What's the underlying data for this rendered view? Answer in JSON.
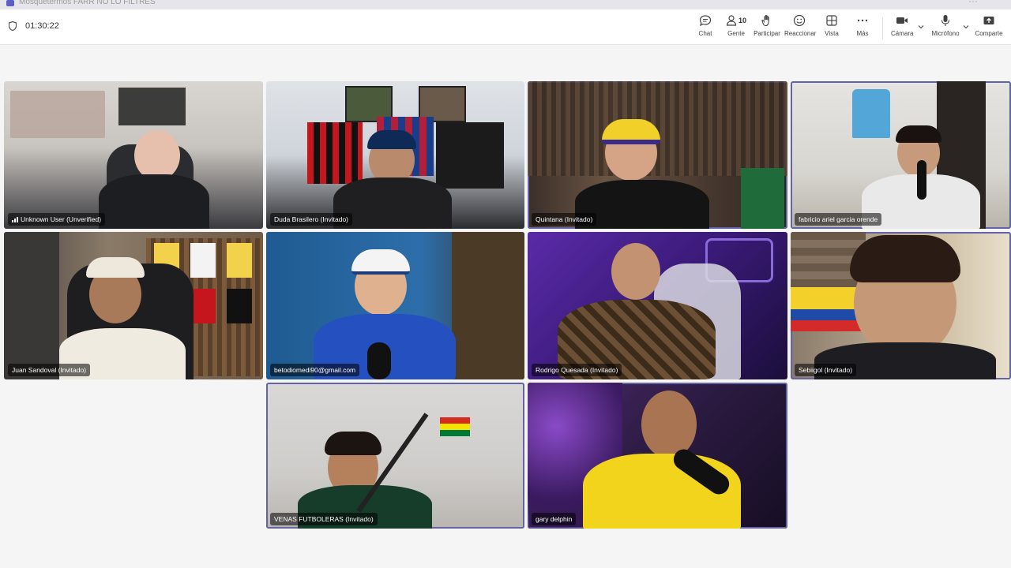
{
  "titlebar": {
    "title": "Mosquetermos FARR NO LO FILTRES"
  },
  "meeting": {
    "timer": "01:30:22"
  },
  "toolbar": {
    "chat": "Chat",
    "people": "Gente",
    "people_count": "10",
    "raise": "Participar",
    "react": "Reaccionar",
    "view": "Vista",
    "more": "Más",
    "camera": "Cámara",
    "mic": "Micrófono",
    "share": "Comparte"
  },
  "participants": [
    {
      "name": "Unknown User (Unverified)"
    },
    {
      "name": "Duda Brasilero (Invitado)"
    },
    {
      "name": "Quintana (Invitado)"
    },
    {
      "name": "fabricio ariel garcia orende"
    },
    {
      "name": "Juan Sandoval (Invitado)"
    },
    {
      "name": "betodiomedi90@gmail.com"
    },
    {
      "name": "Rodrigo Quesada (Invitado)"
    },
    {
      "name": "Sebiigol (Invitado)"
    },
    {
      "name": "VENAS FUTBOLERAS (Invitado)"
    },
    {
      "name": "gary delphin"
    }
  ],
  "colors": {
    "accent": "#6264a7"
  }
}
